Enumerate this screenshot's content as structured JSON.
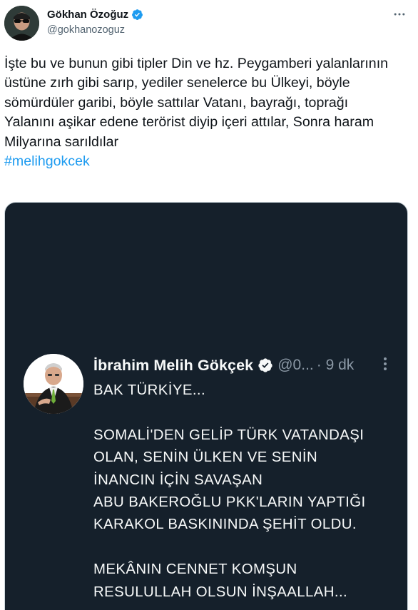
{
  "author": {
    "name": "Gökhan Özoğuz",
    "handle": "@gokhanozoguz",
    "verified": true
  },
  "tweet": {
    "text": "İşte bu ve bunun gibi tipler Din ve hz. Peygamberi yalanlarının üstüne zırh gibi sarıp,  yediler senelerce bu Ülkeyi, böyle sömürdüler garibi, böyle sattılar Vatanı, bayrağı, toprağı\nYalanını aşikar edene terörist diyip içeri attılar, Sonra haram Milyarına sarıldılar",
    "hashtag": "#melihgokcek"
  },
  "embedded": {
    "name": "İbrahim Melih Gökçek",
    "handle": "@0...",
    "time": "· 9 dk",
    "text": "BAK TÜRKİYE...\n\nSOMALİ'DEN GELİP TÜRK VATANDAŞI\nOLAN, SENİN ÜLKEN VE SENİN\nİNANCIN İÇİN SAVAŞAN\nABU BAKEROĞLU PKK'LARIN YAPTIĞI\nKARAKOL BASKININDA ŞEHİT OLDU.\n\nMEKÂNIN CENNET KOMŞUN\nRESULULLAH OLSUN İNŞAALLAH..."
  },
  "colors": {
    "link": "#1d9bf0",
    "verified": "#1d9bf0",
    "media_background": "#15202b",
    "secondary_text": "#536471"
  },
  "icons": [
    "verified-badge-icon",
    "more-horizontal-icon",
    "more-vertical-icon"
  ]
}
